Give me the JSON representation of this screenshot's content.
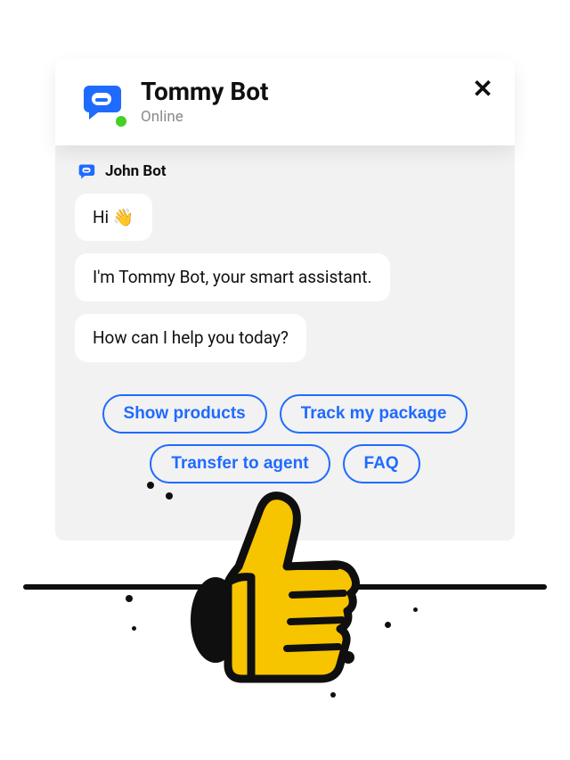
{
  "header": {
    "name": "Tommy Bot",
    "status": "Online"
  },
  "sender": "John Bot",
  "messages": {
    "m0": "Hi 👋",
    "m1": "I'm Tommy Bot, your smart assistant.",
    "m2": "How can I help you today?"
  },
  "quick_replies": {
    "q0": "Show products",
    "q1": "Track my package",
    "q2": "Transfer to agent",
    "q3": "FAQ"
  },
  "colors": {
    "accent": "#1f6bff",
    "online": "#46cf24",
    "thumbs_fill": "#f7c400"
  }
}
